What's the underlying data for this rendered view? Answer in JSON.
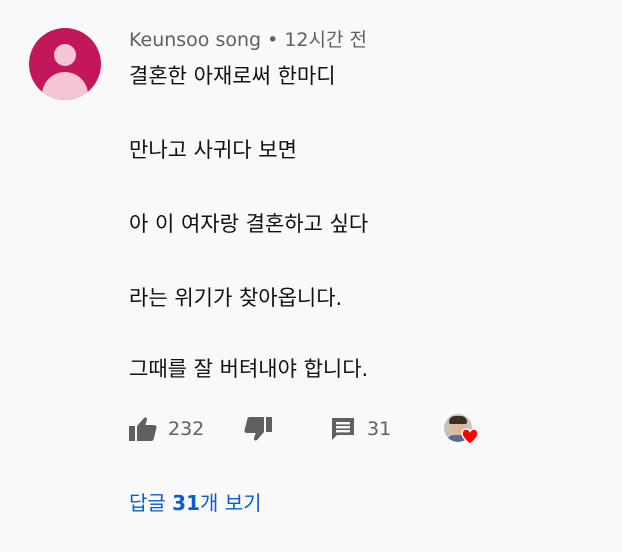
{
  "comment": {
    "author": "Keunsoo song",
    "separator": "•",
    "timestamp": "12시간 전",
    "lines": [
      "결혼한 아재로써 한마디",
      "만나고 사귀다 보면",
      "아 이 여자랑 결혼하고 싶다",
      "라는 위기가 찾아옵니다.",
      "그때를 잘 버텨내야 합니다."
    ],
    "like_count": "232",
    "reply_count": "31",
    "creator_heart": true,
    "avatar_color": "#c2185b"
  },
  "replies_link": {
    "prefix": "답글",
    "count": "31",
    "suffix": "개 보기",
    "color": "#065fd4"
  },
  "icons": {
    "like": "thumbs-up-icon",
    "dislike": "thumbs-down-icon",
    "reply": "comment-icon",
    "heart": "heart-icon"
  }
}
